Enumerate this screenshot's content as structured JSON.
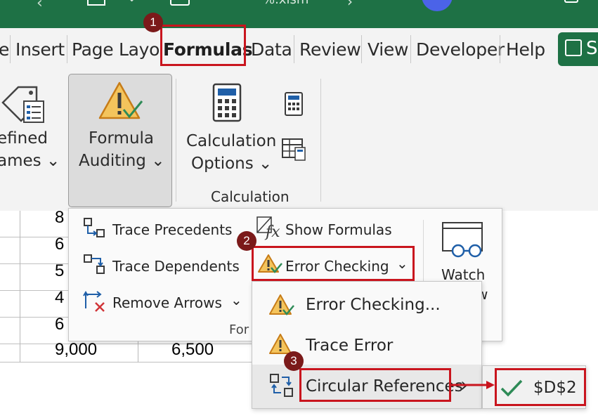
{
  "title_bar": {
    "file_name_fragment": "%.xlsm"
  },
  "tabs": [
    {
      "label": "e"
    },
    {
      "label": "Insert"
    },
    {
      "label": "Page Layo"
    },
    {
      "label": "Formulas"
    },
    {
      "label": "Data"
    },
    {
      "label": "Review"
    },
    {
      "label": "View"
    },
    {
      "label": "Developer"
    },
    {
      "label": "Help"
    }
  ],
  "share_label": "S",
  "ribbon": {
    "defined_names": {
      "line1": "efined",
      "line2": "ames ⌄"
    },
    "formula_auditing": {
      "line1": "Formula",
      "line2": "Auditing ⌄"
    },
    "calculation_options": {
      "line1": "Calculation",
      "line2": "Options ⌄"
    },
    "calculation_group_label": "Calculation"
  },
  "sheet": {
    "col1_values": [
      "8",
      "6",
      "5",
      "4",
      "6",
      "9,000"
    ],
    "col2_values": [
      "6,500"
    ]
  },
  "auditing_menu": {
    "trace_precedents": "Trace Precedents",
    "trace_dependents": "Trace Dependents",
    "remove_arrows": "Remove Arrows",
    "remove_arrows_chevron": "⌄",
    "show_formulas": "Show Formulas",
    "error_checking": "Error Checking",
    "error_checking_chevron": "⌄",
    "group_label": "For",
    "watch_line1": "Watch",
    "watch_line2": "w"
  },
  "error_checking_submenu": {
    "error_checking_item": "Error Checking...",
    "trace_error": "Trace Error",
    "circular_references": "Circular References",
    "arrow": "›"
  },
  "circular_submenu": {
    "cell_ref": "$D$2"
  },
  "badges": {
    "step1": "1",
    "step2": "2",
    "step3": "3"
  },
  "colors": {
    "excel_green": "#1e7145",
    "highlight_red": "#c9151e",
    "badge": "#7b1a1a",
    "warning_orange": "#e8a33d",
    "check_green": "#2e8b57"
  }
}
